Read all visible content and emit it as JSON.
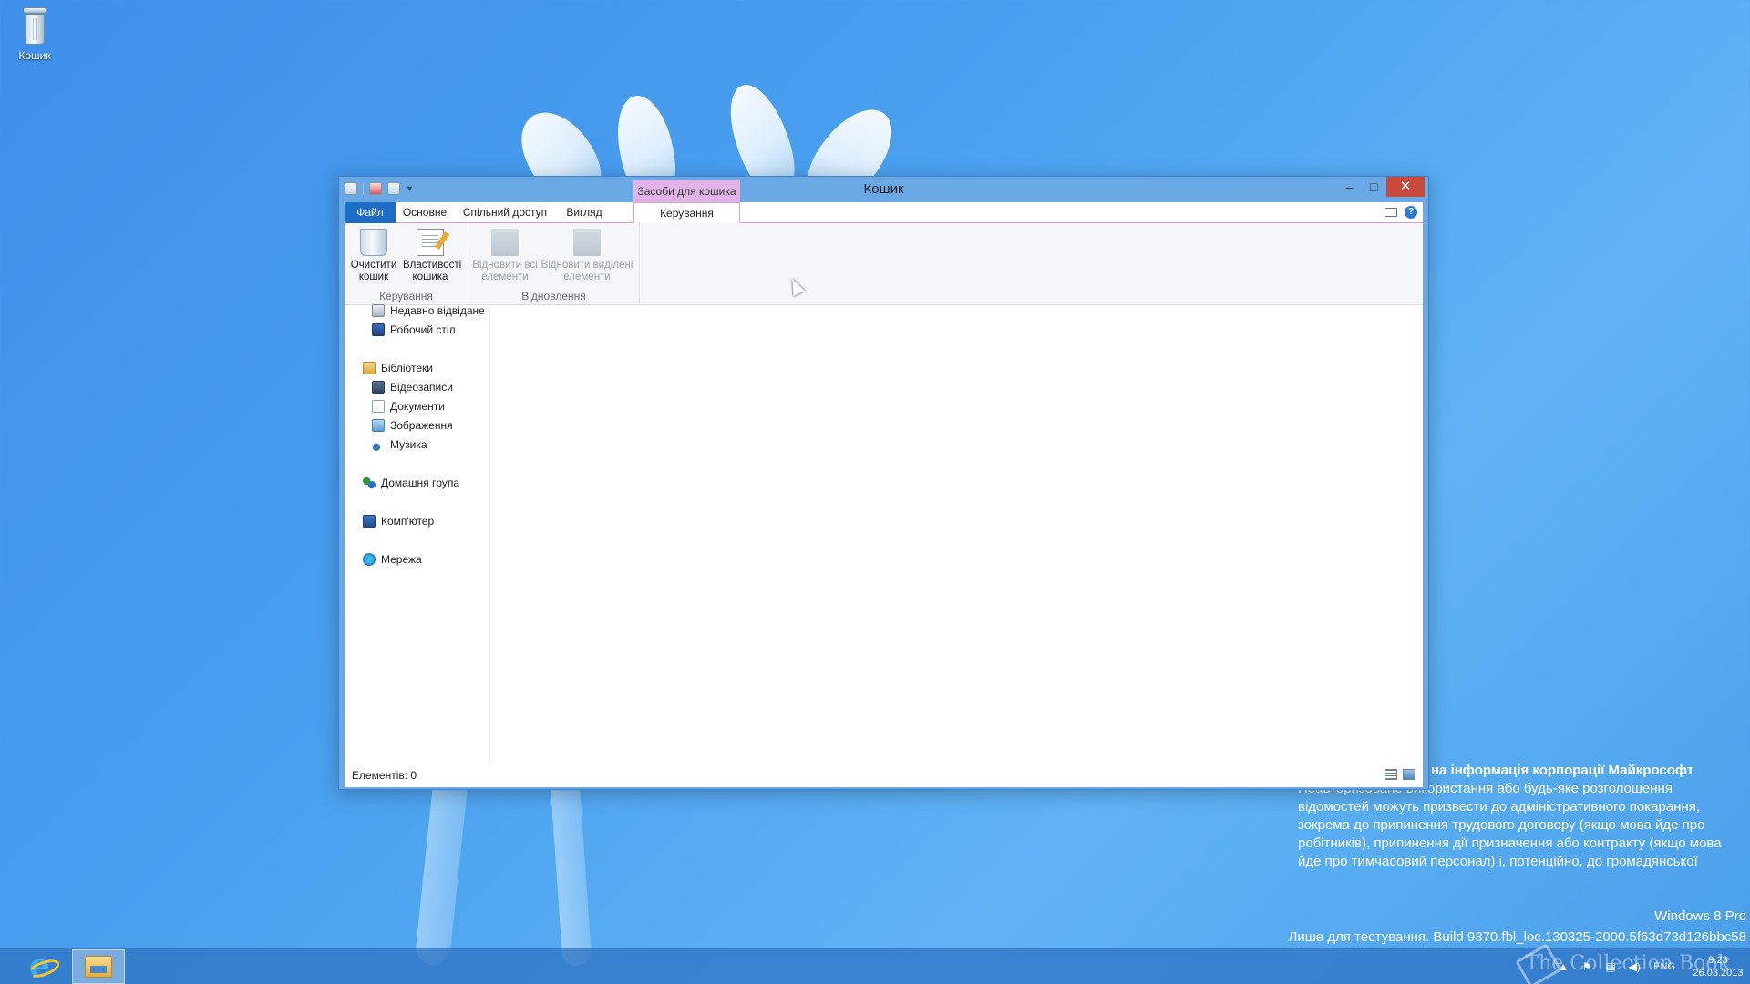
{
  "desktop": {
    "recycle_bin_label": "Кошик",
    "watermark_title": "на інформація корпорації Майкрософт",
    "watermark_body": "Неавторизоване використання або будь-яке розголошення відомостей можуть призвести до адміністративного покарання, зокрема до припинення трудового договору (якщо мова йде про робітників), припинення дії призначення або контракту (якщо мова йде про тимчасовий персонал) і, потенційно, до громадянської",
    "edition": "Windows 8 Pro",
    "build": "Лише для тестування. Build 9370.fbl_loc.130325-2000.5f63d73d126bbc58"
  },
  "window": {
    "title": "Кошик",
    "context_tab_header": "Засоби для кошика",
    "tabs": [
      "Файл",
      "Основне",
      "Спільний доступ",
      "Вигляд",
      "Керування"
    ],
    "ribbon": {
      "group_manage_label": "Керування",
      "group_restore_label": "Відновлення",
      "empty_bin": "Очистити кошик",
      "bin_properties": "Властивості кошика",
      "restore_all": "Відновити всі елементи",
      "restore_selected": "Відновити виділені елементи"
    },
    "nav": {
      "recent": "Недавно відвідане",
      "desktop": "Робочий стіл",
      "libraries": "Бібліотеки",
      "videos": "Відеозаписи",
      "documents": "Документи",
      "pictures": "Зображення",
      "music": "Музика",
      "homegroup": "Домашня група",
      "computer": "Комп'ютер",
      "network": "Мережа"
    },
    "status": "Елементів: 0"
  },
  "taskbar": {
    "language": "ENG",
    "time": "9:23",
    "date": "26.03.2013",
    "watermark": "The Collection Book"
  },
  "colors": {
    "file_tab": "#1d6dc7",
    "context_tab": "#e2b3e6",
    "close_button": "#c74a3b"
  }
}
